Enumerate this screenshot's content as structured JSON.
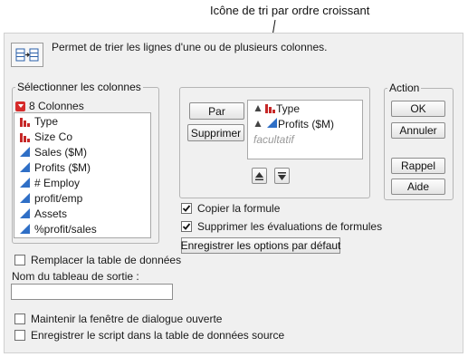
{
  "callout": {
    "text": "Icône de tri par ordre croissant"
  },
  "header": {
    "description": "Permet de trier les lignes d'une ou de plusieurs colonnes.",
    "icon": "sort-table-icon"
  },
  "select_columns": {
    "legend": "Sélectionner les colonnes",
    "count_label": "8 Colonnes",
    "items": [
      {
        "label": "Type",
        "icon": "nominal-bar-icon"
      },
      {
        "label": "Size Co",
        "icon": "nominal-bar-icon"
      },
      {
        "label": "Sales ($M)",
        "icon": "continuous-triangle-icon"
      },
      {
        "label": "Profits ($M)",
        "icon": "continuous-triangle-icon"
      },
      {
        "label": "# Employ",
        "icon": "continuous-triangle-icon"
      },
      {
        "label": "profit/emp",
        "icon": "continuous-triangle-icon"
      },
      {
        "label": "Assets",
        "icon": "continuous-triangle-icon"
      },
      {
        "label": "%profit/sales",
        "icon": "continuous-triangle-icon"
      }
    ]
  },
  "sort_by": {
    "by_button": "Par",
    "remove_button": "Supprimer",
    "items": [
      {
        "label": "Type",
        "icon": "nominal-bar-icon",
        "order_icon": "ascending-sort-icon"
      },
      {
        "label": "Profits ($M)",
        "icon": "continuous-triangle-icon",
        "order_icon": "ascending-sort-icon"
      }
    ],
    "optional_text": "facultatif",
    "ascending_button_icon": "ascending-order-button-icon",
    "descending_button_icon": "descending-order-button-icon"
  },
  "options": {
    "copy_formula": {
      "label": "Copier la formule",
      "checked": true
    },
    "suppress_formula_eval": {
      "label": "Supprimer les évaluations de formules",
      "checked": true
    },
    "save_defaults_button": "Enregistrer les options par défaut",
    "replace_table": {
      "label": "Remplacer la table de données",
      "checked": false
    },
    "output_table_name_label": "Nom du tableau de sortie :",
    "output_table_name_value": "",
    "keep_dialog_open": {
      "label": "Maintenir la fenêtre de dialogue ouverte",
      "checked": false
    },
    "save_script": {
      "label": "Enregistrer le script dans la table de données source",
      "checked": false
    }
  },
  "action": {
    "legend": "Action",
    "ok": "OK",
    "cancel": "Annuler",
    "recall": "Rappel",
    "help": "Aide"
  },
  "colors": {
    "nominal_red": "#c62828",
    "continuous_blue": "#2f6fc6",
    "dialog_bg": "#f0f0f0"
  }
}
